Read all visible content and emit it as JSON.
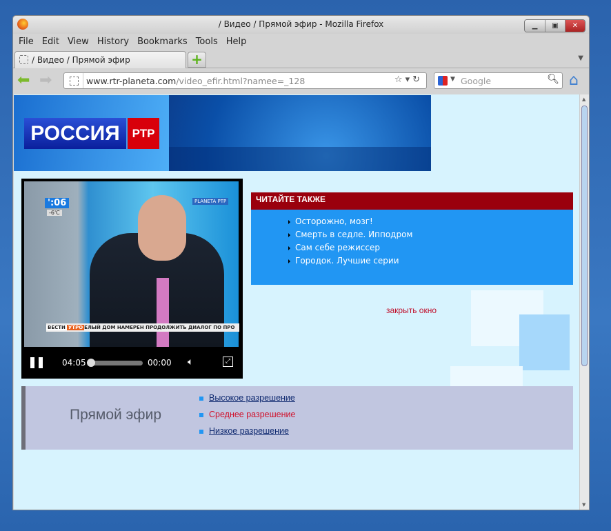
{
  "window": {
    "title": "/ Видео / Прямой эфир - Mozilla Firefox",
    "controls": [
      "minimize",
      "maximize",
      "close"
    ]
  },
  "menu": [
    "File",
    "Edit",
    "View",
    "History",
    "Bookmarks",
    "Tools",
    "Help"
  ],
  "tab": {
    "label": "/ Видео / Прямой эфир",
    "new_tab": "+"
  },
  "nav": {
    "url_domain": "www.rtr-planeta.com",
    "url_path": "/video_efir.html?namee=_128",
    "search_placeholder": "Google"
  },
  "banner": {
    "logo_main": "РОССИЯ",
    "logo_sub": "РТР"
  },
  "video": {
    "clock": "':06",
    "temp": "-6'C",
    "channel": "PLANETA РТР",
    "ticker_brand": "ВЕСТИ",
    "ticker_show": "УТРО",
    "ticker_text": "ЕЛЫЙ ДОМ НАМЕРЕН ПРОДОЛЖИТЬ ДИАЛОГ ПО ПРО",
    "time_current": "04:05",
    "time_end": "00:00",
    "progress": 0
  },
  "read_also": {
    "title": "ЧИТАЙТЕ ТАКЖЕ",
    "items": [
      "Осторожно, мозг!",
      "Смерть в седле. Ипподром",
      "Сам себе режиссер",
      "Городок. Лучшие серии"
    ]
  },
  "close_link": "закрыть окно",
  "live": {
    "title": "Прямой эфир",
    "options": [
      {
        "label": "Высокое разрешение",
        "selected": false
      },
      {
        "label": "Среднее разрешение",
        "selected": true
      },
      {
        "label": "Низкое разрешение",
        "selected": false
      }
    ]
  }
}
